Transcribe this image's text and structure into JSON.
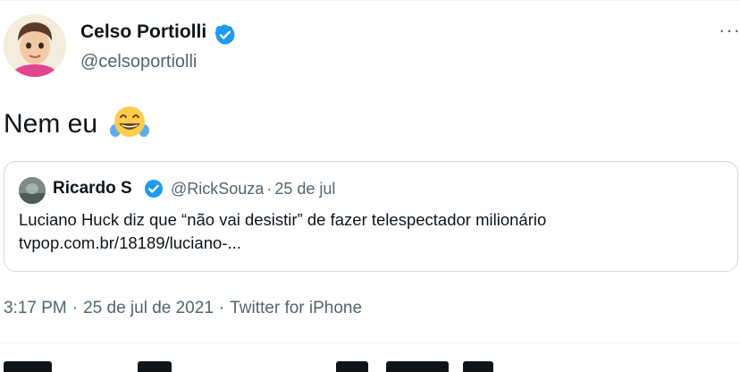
{
  "author": {
    "display_name": "Celso Portiolli",
    "handle": "@celsoportiolli"
  },
  "tweet": {
    "text": "Nem eu",
    "emoji": "face-with-tears-of-joy",
    "more_label": "···"
  },
  "quoted": {
    "display_name": "Ricardo S",
    "handle": "@RickSouza",
    "date": "25 de jul",
    "separator": "·",
    "text": "Luciano Huck diz que “não vai desistir” de fazer telespectador milionário",
    "link": "tvpop.com.br/18189/luciano-..."
  },
  "meta": {
    "time": "3:17 PM",
    "date": "25 de jul de 2021",
    "source": "Twitter for iPhone",
    "separator": "·"
  },
  "colors": {
    "verified": "#1d9bf0",
    "secondary_text": "#536471",
    "border": "#cfd9de"
  }
}
